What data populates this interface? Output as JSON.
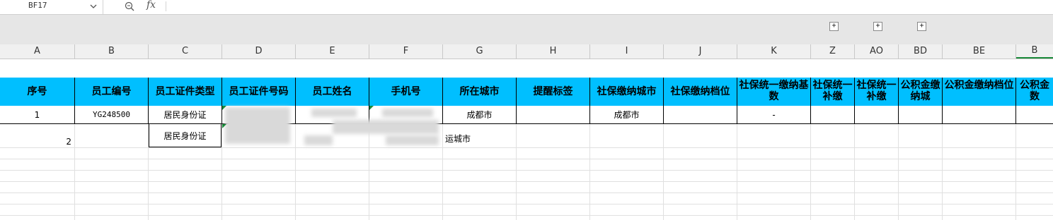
{
  "namebox": {
    "ref": "BF17"
  },
  "formula_bar": {
    "value": ""
  },
  "group_buttons": [
    "+",
    "+",
    "+"
  ],
  "column_headers": [
    "A",
    "B",
    "C",
    "D",
    "E",
    "F",
    "G",
    "H",
    "I",
    "J",
    "K",
    "Z",
    "AO",
    "BD",
    "BE",
    "B"
  ],
  "table_header": [
    "序号",
    "员工编号",
    "员工证件类型",
    "员工证件号码",
    "员工姓名",
    "手机号",
    "所在城市",
    "提醒标签",
    "社保缴纳城市",
    "社保缴纳档位",
    "社保统一缴纳基数",
    "社保统一补缴",
    "社保统一补缴",
    "公积金缴纳城",
    "公积金缴纳档位",
    "公积金数"
  ],
  "rows": [
    {
      "seq": "1",
      "emp_no": "YG248500",
      "id_type": "居民身份证",
      "city": "成都市",
      "ss_city": "成都市",
      "ss_base": "-"
    },
    {
      "seq": "2",
      "emp_no": "",
      "id_type": "居民身份证",
      "city": "运城市",
      "ss_city": "",
      "ss_base": ""
    }
  ],
  "colors": {
    "header_bg": "#00bfff",
    "grid_line": "#e0e0e0",
    "marker": "#1a8a3a"
  }
}
